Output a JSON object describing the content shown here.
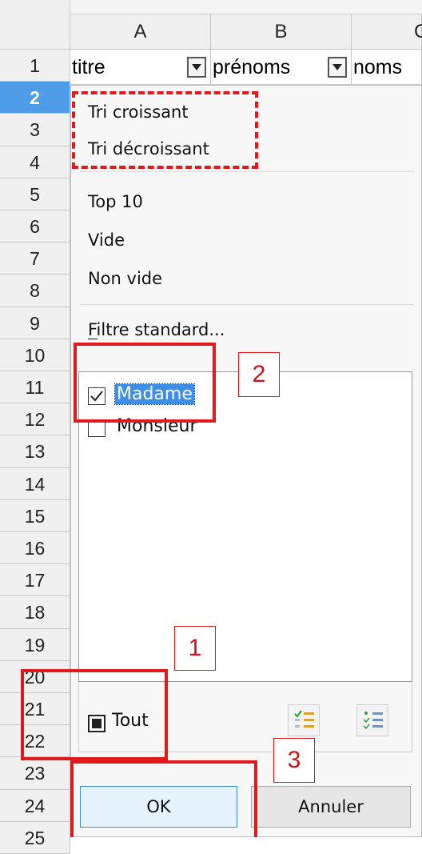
{
  "columns": [
    "A",
    "B",
    "C"
  ],
  "header_cells": [
    "titre",
    "prénoms",
    "noms"
  ],
  "rows": [
    "1",
    "2",
    "3",
    "4",
    "5",
    "6",
    "7",
    "8",
    "9",
    "10",
    "11",
    "12",
    "13",
    "14",
    "15",
    "16",
    "17",
    "18",
    "19",
    "20",
    "21",
    "22",
    "23",
    "24",
    "25"
  ],
  "selected_row": "2",
  "menu": {
    "sort_asc": "Tri croissant",
    "sort_desc": "Tri décroissant",
    "top10": "Top 10",
    "empty": "Vide",
    "not_empty": "Non vide",
    "standard_filter": "Filtre standard..."
  },
  "values_list": [
    {
      "label": "Madame",
      "checked": true,
      "selected": true
    },
    {
      "label": "Monsieur",
      "checked": false,
      "selected": false
    }
  ],
  "all_label": "Tout",
  "ok_label": "OK",
  "cancel_label": "Annuler",
  "callouts": [
    "1",
    "2",
    "3"
  ],
  "colors": {
    "annotation_red": "#e0191c",
    "selection_blue": "#3d8ee6",
    "row_selected": "#4f9de8"
  },
  "icons": [
    "dropdown-arrow-icon",
    "select-current-only-icon",
    "unselect-current-only-icon"
  ]
}
